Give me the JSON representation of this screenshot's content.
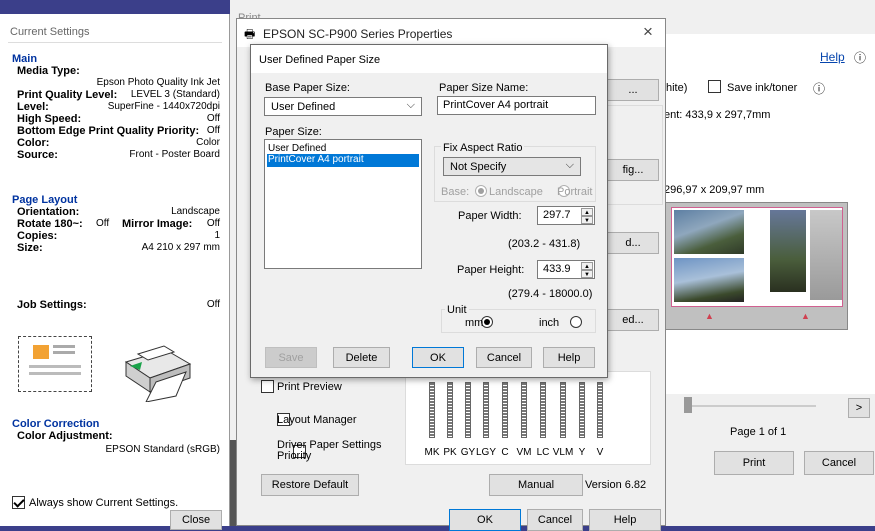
{
  "current_settings": {
    "title": "Current Settings",
    "main_heading": "Main",
    "media_type_label": "Media Type:",
    "media_type_value": "Epson Photo Quality Ink Jet",
    "rows1": [
      {
        "label": "Print Quality Level:",
        "value": "LEVEL 3 (Standard)"
      },
      {
        "label": "Level:",
        "value": "SuperFine - 1440x720dpi"
      },
      {
        "label": "High Speed:",
        "value": "Off"
      },
      {
        "label": "Bottom Edge Print Quality Priority:",
        "value": "Off"
      },
      {
        "label": "Color:",
        "value": "Color"
      },
      {
        "label": "Source:",
        "value": "Front - Poster Board"
      }
    ],
    "page_layout_heading": "Page Layout",
    "orientation_label": "Orientation:",
    "orientation_value": "Landscape",
    "rotate_label": "Rotate 180~:",
    "rotate_value": "Off",
    "mirror_label": "Mirror Image:",
    "mirror_value": "Off",
    "copies_label": "Copies:",
    "copies_value": "1",
    "size_label": "Size:",
    "size_value": "A4 210 x 297 mm",
    "job_settings_label": "Job Settings:",
    "job_settings_value": "Off",
    "color_correction_heading": "Color Correction",
    "color_adjustment_label": "Color Adjustment:",
    "color_adjustment_value": "EPSON Standard (sRGB)",
    "always_show_label": "Always show Current Settings.",
    "close_label": "Close"
  },
  "print_dialog": {
    "title": "Print",
    "help_label": "Help",
    "white_fragment": "hite)",
    "save_ink_label": "Save ink/toner",
    "ent_text": "ent: 433,9 x 297,7mm",
    "size_text": "296,97 x 209,97 mm",
    "page_label": "Page 1 of 1",
    "next_label": ">",
    "print_label": "Print",
    "cancel_label": "Cancel"
  },
  "properties": {
    "title": "EPSON SC-P900 Series Properties",
    "btn_frag_1": "...",
    "btn_frag_2": "fig...",
    "btn_frag_3": "d...",
    "btn_frag_4": "ed...",
    "print_preview": "Print Preview",
    "layout_manager": "Layout Manager",
    "driver_paper": "Driver Paper Settings Priority",
    "restore_default": "Restore Default",
    "manual": "Manual",
    "version": "Version 6.82",
    "ink_labels": [
      "MK",
      "PK",
      "GY",
      "LGY",
      "C",
      "VM",
      "LC",
      "VLM",
      "Y",
      "V"
    ],
    "ok_label": "OK",
    "cancel_label": "Cancel",
    "help_label": "Help"
  },
  "udps": {
    "title": "User Defined Paper Size",
    "base_label": "Base Paper Size:",
    "base_value": "User Defined",
    "name_label": "Paper Size Name:",
    "name_value": "PrintCover A4 portrait",
    "paper_size_label": "Paper Size:",
    "list_items": [
      "User Defined",
      "PrintCover A4 portrait"
    ],
    "fix_label": "Fix Aspect Ratio",
    "fix_value": "Not Specify",
    "base_ratio_label": "Base:",
    "landscape_label": "Landscape",
    "portrait_label": "Portrait",
    "width_label": "Paper Width:",
    "width_value": "297.7",
    "width_range": "(203.2 - 431.8)",
    "height_label": "Paper Height:",
    "height_value": "433.9",
    "height_range": "(279.4 - 18000.0)",
    "unit_label": "Unit",
    "mm_label": "mm",
    "inch_label": "inch",
    "save_label": "Save",
    "delete_label": "Delete",
    "ok_label": "OK",
    "cancel_label": "Cancel",
    "help_label": "Help"
  }
}
